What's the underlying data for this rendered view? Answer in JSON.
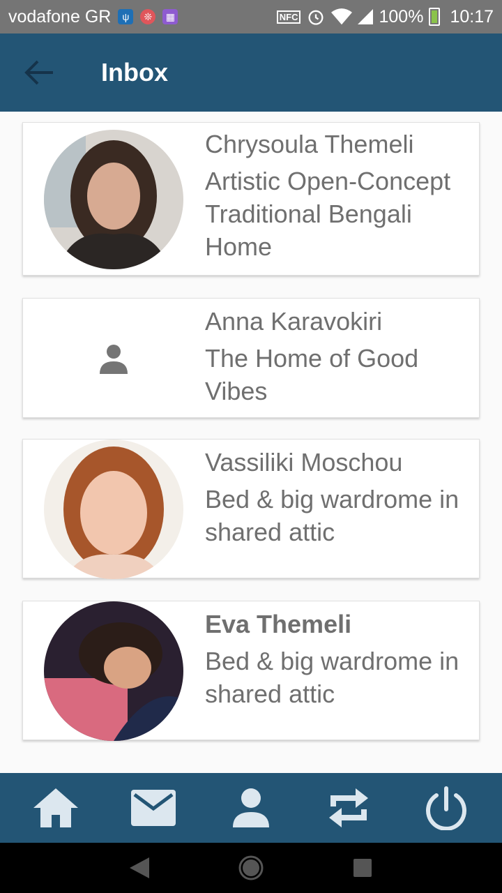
{
  "status_bar": {
    "carrier": "vodafone GR",
    "nfc": "NFC",
    "battery": "100%",
    "time": "10:17"
  },
  "app_bar": {
    "title": "Inbox"
  },
  "messages": [
    {
      "sender": "Chrysoula Themeli",
      "subject": "Artistic Open-Concept Traditional Bengali Home",
      "unread": false,
      "avatar": "photo"
    },
    {
      "sender": "Anna Karavokiri",
      "subject": "The Home of Good Vibes",
      "unread": false,
      "avatar": "person-icon"
    },
    {
      "sender": "Vassiliki Moschou",
      "subject": "Bed & big wardrome in shared attic",
      "unread": false,
      "avatar": "photo"
    },
    {
      "sender": "Eva Themeli",
      "subject": "Bed & big wardrome in shared attic",
      "unread": true,
      "avatar": "photo"
    }
  ],
  "bottom_nav": {
    "items": [
      "home-icon",
      "mail-icon",
      "profile-icon",
      "swap-icon",
      "power-icon"
    ]
  },
  "colors": {
    "primary": "#235575",
    "text": "#6f6f6f",
    "nav_icon": "#dce7ef"
  }
}
